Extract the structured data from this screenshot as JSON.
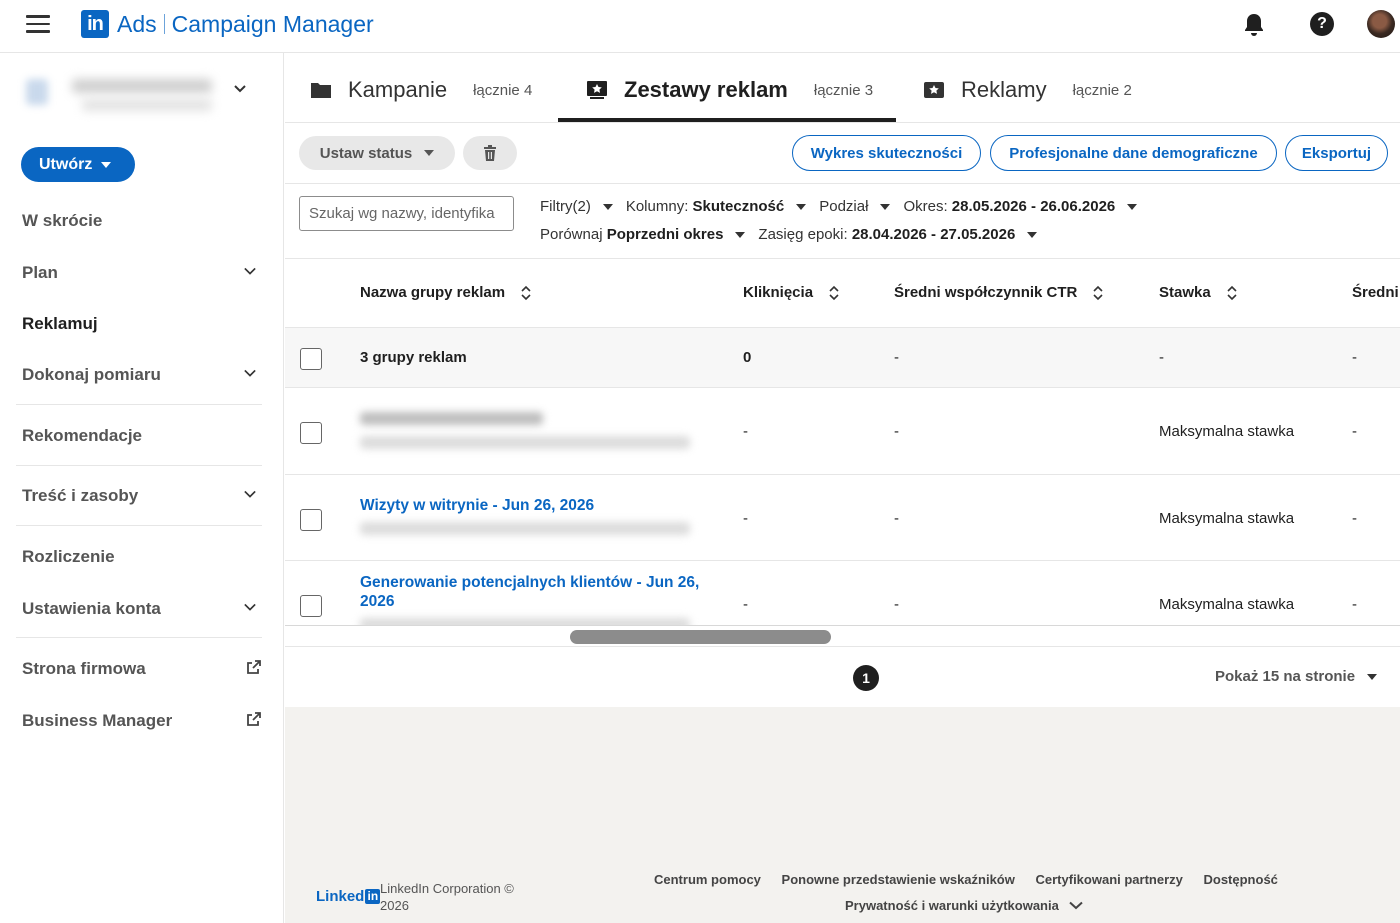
{
  "app": {
    "brand_ads": "Ads",
    "brand_name": "Campaign Manager"
  },
  "sidebar": {
    "create_label": "Utwórz",
    "items": [
      {
        "label": "W skrócie"
      },
      {
        "label": "Plan"
      },
      {
        "label": "Reklamuj"
      },
      {
        "label": "Dokonaj pomiaru"
      },
      {
        "label": "Rekomendacje"
      },
      {
        "label": "Treść i zasoby"
      },
      {
        "label": "Rozliczenie"
      },
      {
        "label": "Ustawienia konta"
      },
      {
        "label": "Strona firmowa"
      },
      {
        "label": "Business Manager"
      }
    ]
  },
  "tabs": [
    {
      "label": "Kampanie",
      "count": "łącznie 4"
    },
    {
      "label": "Zestawy reklam",
      "count": "łącznie 3"
    },
    {
      "label": "Reklamy",
      "count": "łącznie 2"
    }
  ],
  "toolbar": {
    "set_status": "Ustaw status",
    "performance_chart": "Wykres skuteczności",
    "demographics": "Profesjonalne dane demograficzne",
    "export": "Eksportuj"
  },
  "filters": {
    "search_placeholder": "Szukaj wg nazwy, identyfika",
    "filters_label": "Filtry(2)",
    "columns_label": "Kolumny:",
    "columns_value": "Skuteczność",
    "breakdown_label": "Podział",
    "period_label": "Okres:",
    "period_value": "28.05.2026 - 26.06.2026",
    "compare_label": "Porównaj",
    "compare_value": "Poprzedni okres",
    "epoch_label": "Zasięg epoki:",
    "epoch_value": "28.04.2026 - 27.05.2026"
  },
  "table": {
    "columns": [
      "Nazwa grupy reklam",
      "Kliknięcia",
      "Średni współczynnik CTR",
      "Stawka",
      "Średni"
    ],
    "summary": {
      "name": "3 grupy reklam",
      "clicks": "0",
      "ctr": "-",
      "bid": "-",
      "avg": "-"
    },
    "rows": [
      {
        "name": "",
        "clicks": "-",
        "ctr": "-",
        "bid": "Maksymalna stawka",
        "avg": "-"
      },
      {
        "name": "Wizyty w witrynie - Jun 26, 2026",
        "clicks": "-",
        "ctr": "-",
        "bid": "Maksymalna stawka",
        "avg": "-"
      },
      {
        "name": "Generowanie potencjalnych klientów - Jun 26, 2026",
        "clicks": "-",
        "ctr": "-",
        "bid": "Maksymalna stawka",
        "avg": "-"
      }
    ]
  },
  "pagination": {
    "current_page": "1",
    "per_page": "Pokaż 15 na stronie"
  },
  "footer": {
    "logo_text": "Linked",
    "logo_in": "in",
    "copyright": "LinkedIn Corporation © 2026",
    "links": [
      "Centrum pomocy",
      "Ponowne przedstawienie wskaźników",
      "Certyfikowani partnerzy",
      "Dostępność"
    ],
    "privacy": "Prywatność i warunki użytkowania"
  },
  "colors": {
    "brand": "#0a66c2",
    "text": "#1f1f1f",
    "muted": "#555555",
    "background": "#f3f2ef"
  }
}
